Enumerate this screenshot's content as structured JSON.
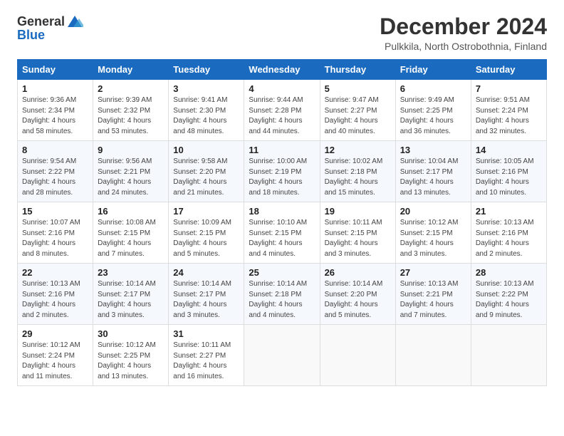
{
  "header": {
    "logo": {
      "general": "General",
      "blue": "Blue"
    },
    "title": "December 2024",
    "subtitle": "Pulkkila, North Ostrobothnia, Finland"
  },
  "weekdays": [
    "Sunday",
    "Monday",
    "Tuesday",
    "Wednesday",
    "Thursday",
    "Friday",
    "Saturday"
  ],
  "weeks": [
    [
      {
        "day": "1",
        "info": "Sunrise: 9:36 AM\nSunset: 2:34 PM\nDaylight: 4 hours\nand 58 minutes."
      },
      {
        "day": "2",
        "info": "Sunrise: 9:39 AM\nSunset: 2:32 PM\nDaylight: 4 hours\nand 53 minutes."
      },
      {
        "day": "3",
        "info": "Sunrise: 9:41 AM\nSunset: 2:30 PM\nDaylight: 4 hours\nand 48 minutes."
      },
      {
        "day": "4",
        "info": "Sunrise: 9:44 AM\nSunset: 2:28 PM\nDaylight: 4 hours\nand 44 minutes."
      },
      {
        "day": "5",
        "info": "Sunrise: 9:47 AM\nSunset: 2:27 PM\nDaylight: 4 hours\nand 40 minutes."
      },
      {
        "day": "6",
        "info": "Sunrise: 9:49 AM\nSunset: 2:25 PM\nDaylight: 4 hours\nand 36 minutes."
      },
      {
        "day": "7",
        "info": "Sunrise: 9:51 AM\nSunset: 2:24 PM\nDaylight: 4 hours\nand 32 minutes."
      }
    ],
    [
      {
        "day": "8",
        "info": "Sunrise: 9:54 AM\nSunset: 2:22 PM\nDaylight: 4 hours\nand 28 minutes."
      },
      {
        "day": "9",
        "info": "Sunrise: 9:56 AM\nSunset: 2:21 PM\nDaylight: 4 hours\nand 24 minutes."
      },
      {
        "day": "10",
        "info": "Sunrise: 9:58 AM\nSunset: 2:20 PM\nDaylight: 4 hours\nand 21 minutes."
      },
      {
        "day": "11",
        "info": "Sunrise: 10:00 AM\nSunset: 2:19 PM\nDaylight: 4 hours\nand 18 minutes."
      },
      {
        "day": "12",
        "info": "Sunrise: 10:02 AM\nSunset: 2:18 PM\nDaylight: 4 hours\nand 15 minutes."
      },
      {
        "day": "13",
        "info": "Sunrise: 10:04 AM\nSunset: 2:17 PM\nDaylight: 4 hours\nand 13 minutes."
      },
      {
        "day": "14",
        "info": "Sunrise: 10:05 AM\nSunset: 2:16 PM\nDaylight: 4 hours\nand 10 minutes."
      }
    ],
    [
      {
        "day": "15",
        "info": "Sunrise: 10:07 AM\nSunset: 2:16 PM\nDaylight: 4 hours\nand 8 minutes."
      },
      {
        "day": "16",
        "info": "Sunrise: 10:08 AM\nSunset: 2:15 PM\nDaylight: 4 hours\nand 7 minutes."
      },
      {
        "day": "17",
        "info": "Sunrise: 10:09 AM\nSunset: 2:15 PM\nDaylight: 4 hours\nand 5 minutes."
      },
      {
        "day": "18",
        "info": "Sunrise: 10:10 AM\nSunset: 2:15 PM\nDaylight: 4 hours\nand 4 minutes."
      },
      {
        "day": "19",
        "info": "Sunrise: 10:11 AM\nSunset: 2:15 PM\nDaylight: 4 hours\nand 3 minutes."
      },
      {
        "day": "20",
        "info": "Sunrise: 10:12 AM\nSunset: 2:15 PM\nDaylight: 4 hours\nand 3 minutes."
      },
      {
        "day": "21",
        "info": "Sunrise: 10:13 AM\nSunset: 2:16 PM\nDaylight: 4 hours\nand 2 minutes."
      }
    ],
    [
      {
        "day": "22",
        "info": "Sunrise: 10:13 AM\nSunset: 2:16 PM\nDaylight: 4 hours\nand 2 minutes."
      },
      {
        "day": "23",
        "info": "Sunrise: 10:14 AM\nSunset: 2:17 PM\nDaylight: 4 hours\nand 3 minutes."
      },
      {
        "day": "24",
        "info": "Sunrise: 10:14 AM\nSunset: 2:17 PM\nDaylight: 4 hours\nand 3 minutes."
      },
      {
        "day": "25",
        "info": "Sunrise: 10:14 AM\nSunset: 2:18 PM\nDaylight: 4 hours\nand 4 minutes."
      },
      {
        "day": "26",
        "info": "Sunrise: 10:14 AM\nSunset: 2:20 PM\nDaylight: 4 hours\nand 5 minutes."
      },
      {
        "day": "27",
        "info": "Sunrise: 10:13 AM\nSunset: 2:21 PM\nDaylight: 4 hours\nand 7 minutes."
      },
      {
        "day": "28",
        "info": "Sunrise: 10:13 AM\nSunset: 2:22 PM\nDaylight: 4 hours\nand 9 minutes."
      }
    ],
    [
      {
        "day": "29",
        "info": "Sunrise: 10:12 AM\nSunset: 2:24 PM\nDaylight: 4 hours\nand 11 minutes."
      },
      {
        "day": "30",
        "info": "Sunrise: 10:12 AM\nSunset: 2:25 PM\nDaylight: 4 hours\nand 13 minutes."
      },
      {
        "day": "31",
        "info": "Sunrise: 10:11 AM\nSunset: 2:27 PM\nDaylight: 4 hours\nand 16 minutes."
      },
      {
        "day": "",
        "info": ""
      },
      {
        "day": "",
        "info": ""
      },
      {
        "day": "",
        "info": ""
      },
      {
        "day": "",
        "info": ""
      }
    ]
  ]
}
